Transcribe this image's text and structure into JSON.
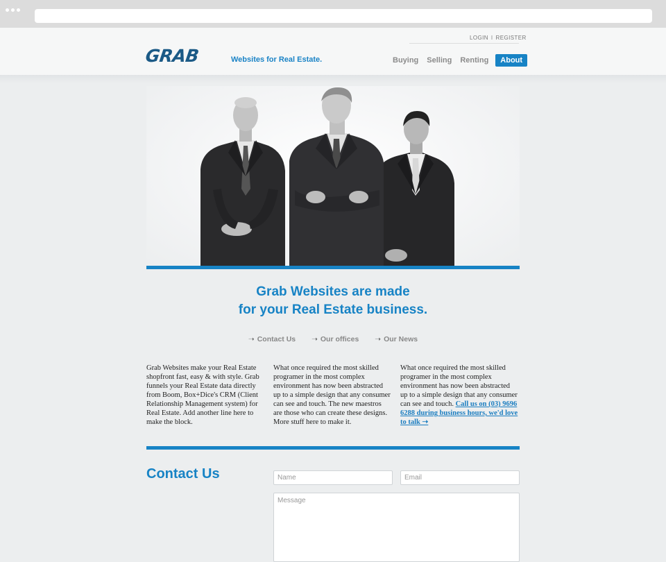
{
  "auth": {
    "login": "LOGIN",
    "separator": "I",
    "register": "REGISTER"
  },
  "brand": {
    "logo": "GRAB",
    "tagline": "Websites for Real Estate."
  },
  "nav": [
    {
      "label": "Buying",
      "active": false
    },
    {
      "label": "Selling",
      "active": false
    },
    {
      "label": "Renting",
      "active": false
    },
    {
      "label": "About",
      "active": true
    }
  ],
  "hero": {
    "image": "three-businessmen-photo"
  },
  "headline": {
    "line1": "Grab Websites are made",
    "line2": "for your Real Estate business."
  },
  "links": [
    {
      "arrow": "➝",
      "label": "Contact Us"
    },
    {
      "arrow": "➝",
      "label": "Our offices"
    },
    {
      "arrow": "➝",
      "label": "Our News"
    }
  ],
  "columns": {
    "col1": "Grab Websites make your Real Estate shopfront fast, easy & with style. Grab funnels your Real Estate data directly from Boom, Box+Dice's CRM (Client Relationship Management system) for Real Estate. Add another line here to make the block.",
    "col2": "What once required the most skilled programer in the most complex environment has now been abstracted up to a simple design that any consumer can see and touch. The new maestros are those who can create these designs. More stuff here to make it.",
    "col3_text": "What once required the most skilled programer in the most complex environment has now been abstracted up to a simple design that any consumer can see and touch.",
    "col3_link": "Call us on (03) 9696 6288 during business hours, we'd love to talk ➝"
  },
  "contact": {
    "title": "Contact Us",
    "name_placeholder": "Name",
    "email_placeholder": "Email",
    "message_placeholder": "Message"
  },
  "colors": {
    "accent": "#1783c5",
    "logo": "#1b5a86",
    "background": "#eceeef"
  }
}
